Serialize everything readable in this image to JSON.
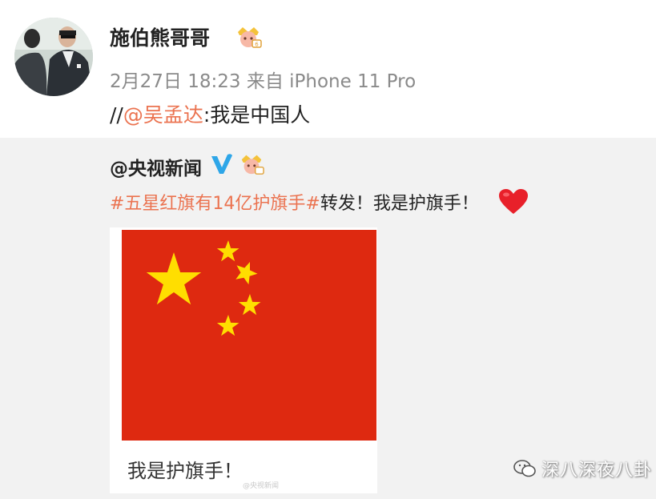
{
  "post": {
    "author": "施伯熊哥哥",
    "date": "2月27日 18:23",
    "source_prefix": "来自",
    "device": "iPhone 11 Pro",
    "repost_slashes": "//",
    "mention": "@吴孟达",
    "repost_body": ":我是中国人"
  },
  "quoted": {
    "author": "@央视新闻",
    "topic": "#五星红旗有14亿护旗手#",
    "body": "转发！我是护旗手！",
    "card_caption": "我是护旗手！",
    "card_watermark": "@央视新闻"
  },
  "watermark": {
    "text": "深八深夜八卦"
  },
  "colors": {
    "mention": "#eb7350",
    "flag_red": "#de2910",
    "flag_star": "#ffde00",
    "verified_blue": "#2ea6e8"
  }
}
